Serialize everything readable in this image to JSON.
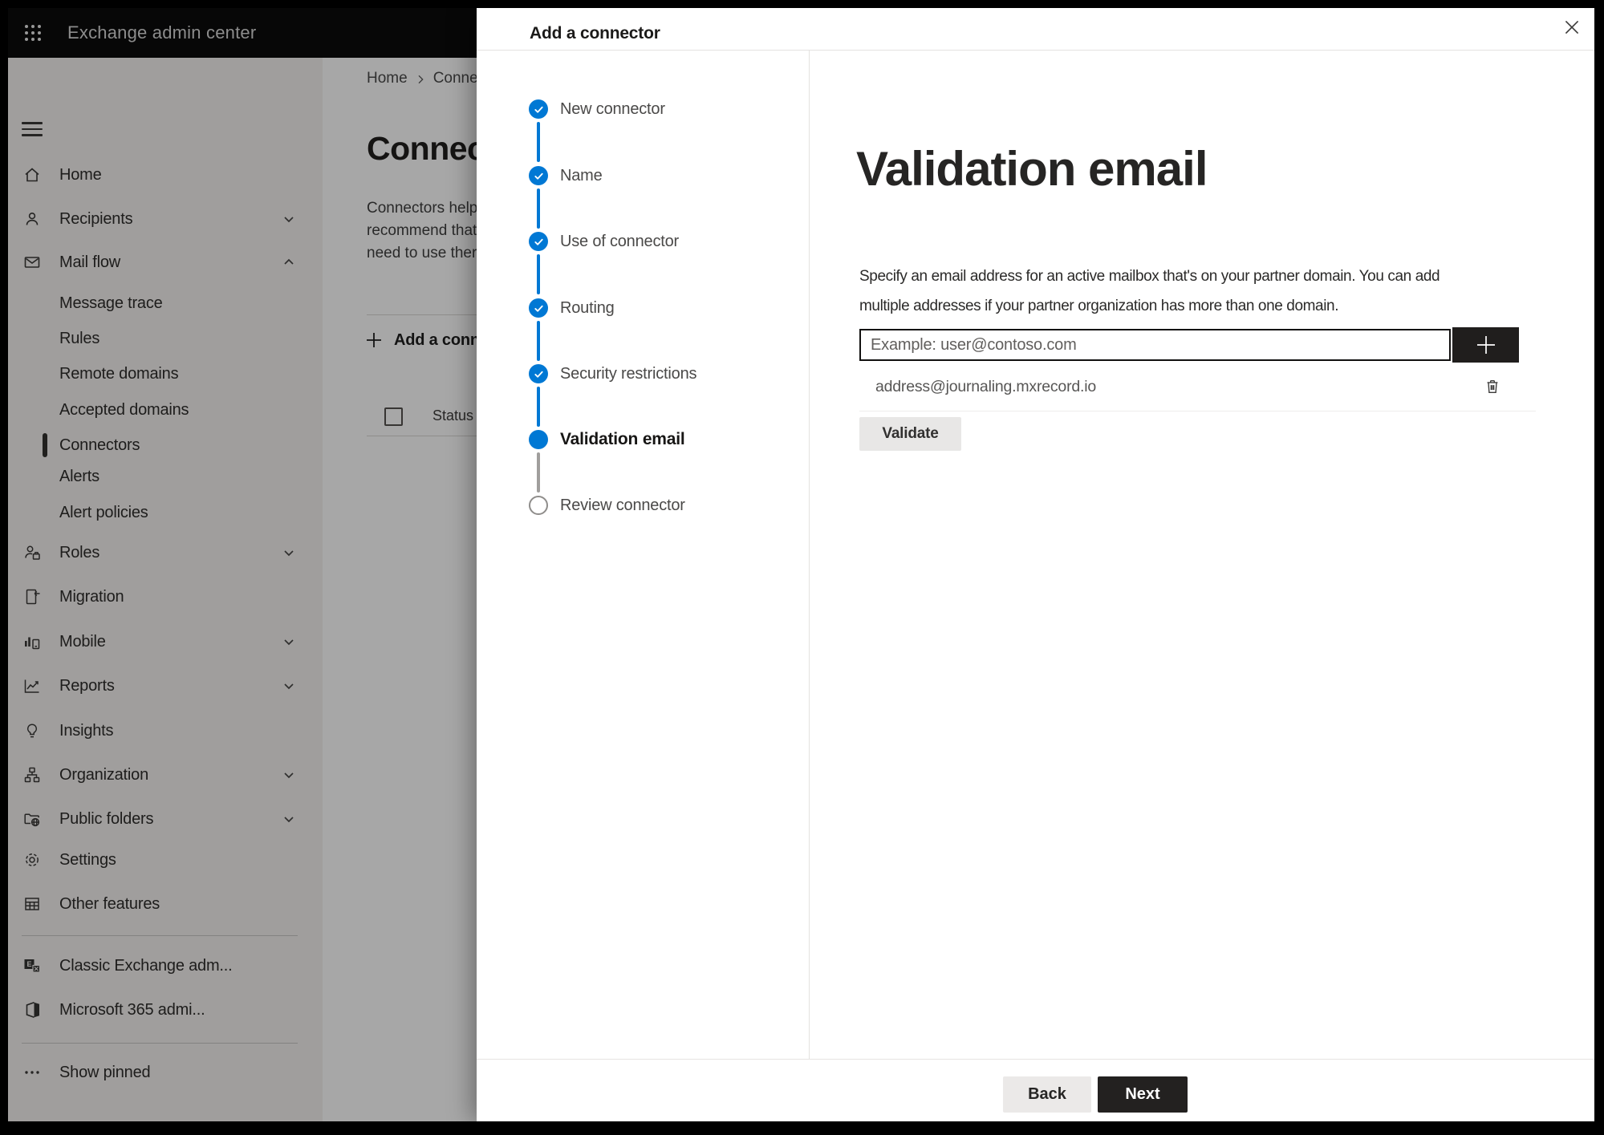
{
  "topbar": {
    "app_title": "Exchange admin center"
  },
  "sidebar": {
    "items": [
      {
        "label": "Home"
      },
      {
        "label": "Recipients"
      },
      {
        "label": "Mail flow"
      },
      {
        "label": "Message trace"
      },
      {
        "label": "Rules"
      },
      {
        "label": "Remote domains"
      },
      {
        "label": "Accepted domains"
      },
      {
        "label": "Connectors"
      },
      {
        "label": "Alerts"
      },
      {
        "label": "Alert policies"
      },
      {
        "label": "Roles"
      },
      {
        "label": "Migration"
      },
      {
        "label": "Mobile"
      },
      {
        "label": "Reports"
      },
      {
        "label": "Insights"
      },
      {
        "label": "Organization"
      },
      {
        "label": "Public folders"
      },
      {
        "label": "Settings"
      },
      {
        "label": "Other features"
      },
      {
        "label": "Classic Exchange adm..."
      },
      {
        "label": "Microsoft 365 admi..."
      },
      {
        "label": "Show pinned"
      }
    ]
  },
  "page": {
    "breadcrumb": {
      "home": "Home",
      "current": "Conne"
    },
    "title": "Connect",
    "intro": "Connectors help\nrecommend that\nneed to use ther",
    "add_button": "Add a conn",
    "status_header": "Status"
  },
  "modal": {
    "title": "Add a connector",
    "steps": [
      {
        "label": "New connector",
        "state": "completed"
      },
      {
        "label": "Name",
        "state": "completed"
      },
      {
        "label": "Use of connector",
        "state": "completed"
      },
      {
        "label": "Routing",
        "state": "completed"
      },
      {
        "label": "Security restrictions",
        "state": "completed"
      },
      {
        "label": "Validation email",
        "state": "current"
      },
      {
        "label": "Review connector",
        "state": "upcoming"
      }
    ],
    "heading": "Validation email",
    "description": "Specify an email address for an active mailbox that's on your partner domain. You can add\nmultiple addresses if your partner organization has more than one domain.",
    "email_input_placeholder": "Example: user@contoso.com",
    "added_email": "address@journaling.mxrecord.io",
    "validate_button": "Validate",
    "back_button": "Back",
    "next_button": "Next",
    "accent_color": "#0078d4"
  }
}
